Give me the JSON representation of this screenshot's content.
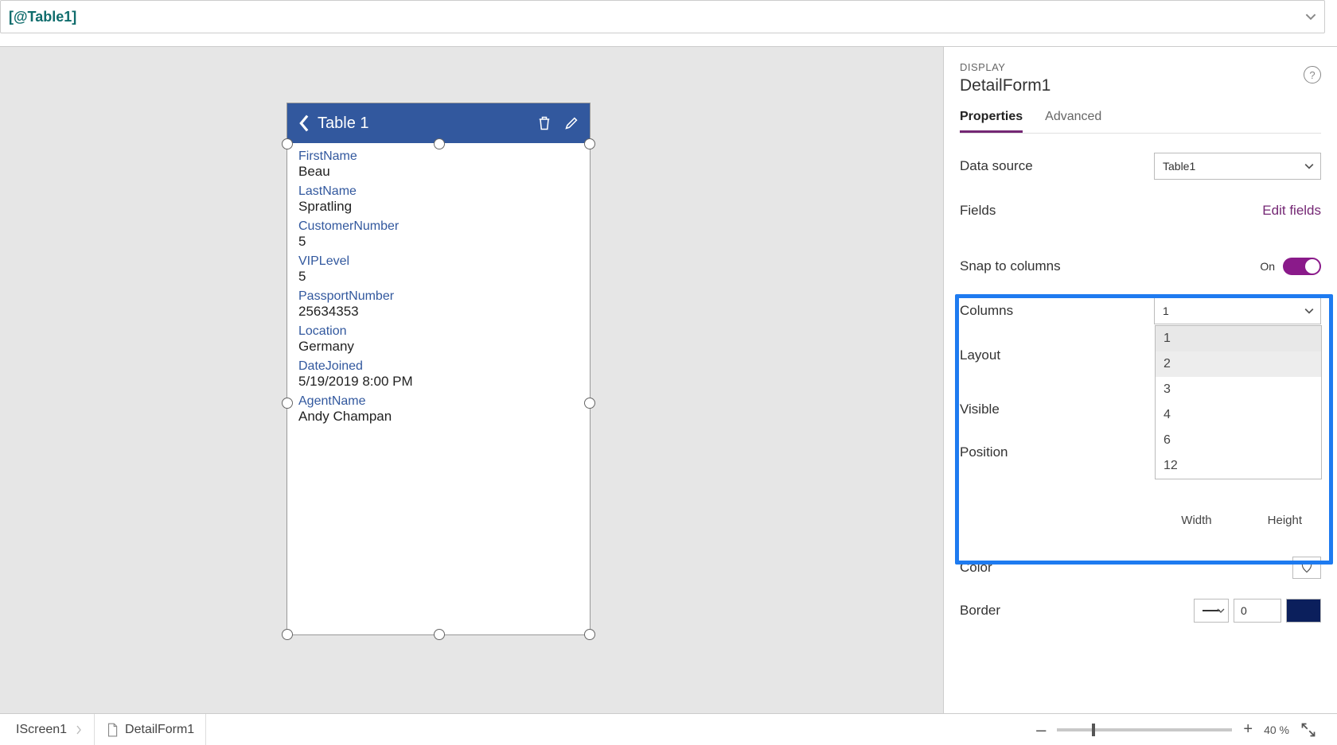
{
  "formula_bar": {
    "text": "[@Table1]"
  },
  "canvas": {
    "header_title": "Table 1",
    "fields": [
      {
        "label": "FirstName",
        "value": "Beau"
      },
      {
        "label": "LastName",
        "value": "Spratling"
      },
      {
        "label": "CustomerNumber",
        "value": "5"
      },
      {
        "label": "VIPLevel",
        "value": "5"
      },
      {
        "label": "PassportNumber",
        "value": "25634353"
      },
      {
        "label": "Location",
        "value": "Germany"
      },
      {
        "label": "DateJoined",
        "value": "5/19/2019 8:00 PM"
      },
      {
        "label": "AgentName",
        "value": "Andy Champan"
      }
    ]
  },
  "panel": {
    "display_label": "DISPLAY",
    "name": "DetailForm1",
    "tabs": {
      "properties": "Properties",
      "advanced": "Advanced"
    },
    "data_source": {
      "label": "Data source",
      "value": "Table1"
    },
    "fields_row": {
      "label": "Fields",
      "link": "Edit fields"
    },
    "snap": {
      "label": "Snap to columns",
      "state": "On"
    },
    "columns": {
      "label": "Columns",
      "value": "1",
      "options": [
        "1",
        "2",
        "3",
        "4",
        "6",
        "12"
      ]
    },
    "layout": {
      "label": "Layout"
    },
    "visible": {
      "label": "Visible"
    },
    "position": {
      "label": "Position"
    },
    "wh": {
      "width": "Width",
      "height": "Height"
    },
    "color": {
      "label": "Color"
    },
    "border": {
      "label": "Border",
      "value": "0"
    }
  },
  "footer": {
    "crumb1": "IScreen1",
    "crumb2": "DetailForm1",
    "zoom_minus": "–",
    "zoom_plus": "+",
    "zoom_text": "40  %"
  }
}
